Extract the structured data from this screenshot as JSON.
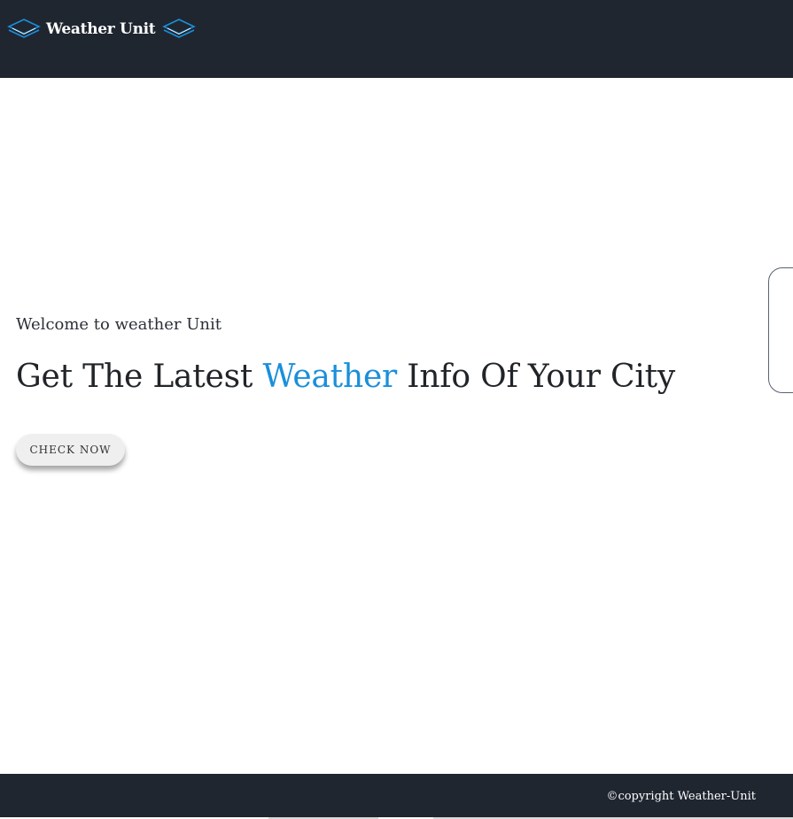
{
  "navbar": {
    "brand_name": "Weather Unit",
    "left_icon": "layers-icon",
    "right_icon": "layers-icon",
    "background": "#1f2630"
  },
  "hero": {
    "welcome_text": "Welcome to weather Unit",
    "headline_before": "Get The Latest ",
    "headline_accent": "Weather",
    "headline_after": " Info Of Your City",
    "accent_color": "#1a8fdb",
    "cta_label": "CHECK NOW"
  },
  "footer": {
    "copyright": "©copyright Weather-Unit",
    "background": "#1f2630"
  }
}
